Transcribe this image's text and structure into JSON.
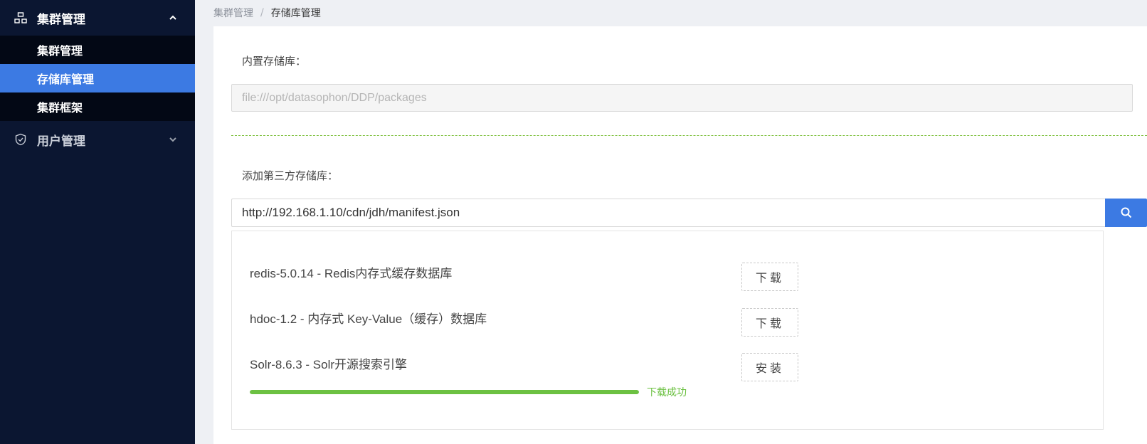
{
  "sidebar": {
    "group_cluster": {
      "label": "集群管理",
      "icon": "cluster-icon",
      "expanded": true
    },
    "items": [
      {
        "label": "集群管理",
        "active": false
      },
      {
        "label": "存储库管理",
        "active": true
      },
      {
        "label": "集群框架",
        "active": false
      }
    ],
    "group_user": {
      "label": "用户管理",
      "icon": "shield-check-icon",
      "expanded": false
    }
  },
  "breadcrumb": {
    "parent": "集群管理",
    "separator": "/",
    "current": "存储库管理"
  },
  "builtin": {
    "label": "内置存储库：",
    "value": "file:///opt/datasophon/DDP/packages"
  },
  "third_party": {
    "label": "添加第三方存储库：",
    "url": "http://192.168.1.10/cdn/jdh/manifest.json",
    "search_icon": "search-icon"
  },
  "packages": [
    {
      "name": "redis-5.0.14 - Redis内存式缓存数据库",
      "action": "下载"
    },
    {
      "name": "hdoc-1.2 - 内存式 Key-Value（缓存）数据库",
      "action": "下载"
    },
    {
      "name": "Solr-8.6.3 - Solr开源搜索引擎",
      "action": "安装",
      "progress": 1.0,
      "status": "下载成功"
    }
  ],
  "colors": {
    "accent": "#3c7ae3",
    "success": "#6cc142",
    "sidebar_bg": "#0b1631"
  }
}
